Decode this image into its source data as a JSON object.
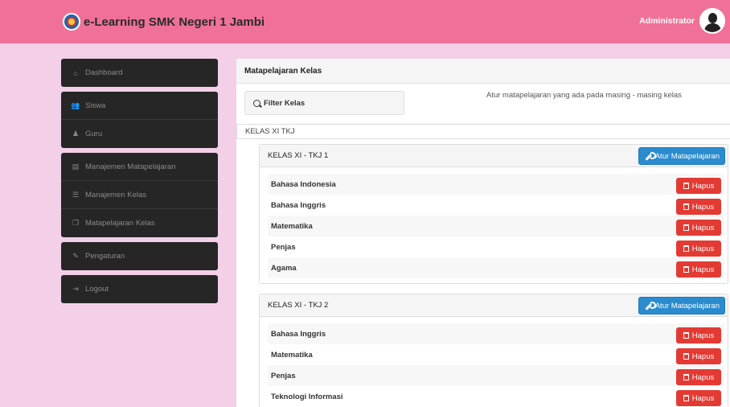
{
  "header": {
    "brand": "e-Learning SMK Negeri 1 Jambi",
    "user": "Administrator"
  },
  "sidebar": {
    "groups": [
      [
        {
          "label": "Dashboard",
          "icon": "home-icon"
        }
      ],
      [
        {
          "label": "Siswa",
          "icon": "users-icon"
        },
        {
          "label": "Guru",
          "icon": "user-icon"
        }
      ],
      [
        {
          "label": "Manajemen Matapelajaran",
          "icon": "book-icon"
        },
        {
          "label": "Manajemen Kelas",
          "icon": "list-icon"
        },
        {
          "label": "Matapelajaran Kelas",
          "icon": "copy-icon"
        }
      ],
      [
        {
          "label": "Pengaturan",
          "icon": "wrench-icon"
        }
      ],
      [
        {
          "label": "Logout",
          "icon": "logout-icon"
        }
      ]
    ]
  },
  "main": {
    "title": "Matapelajaran Kelas",
    "filter_label": "Filter Kelas",
    "description": "Atur matapelajaran yang ada pada masing - masing kelas",
    "section": "KELAS XI TKJ",
    "atur_label": "Atur Matapelajaran",
    "hapus_label": "Hapus",
    "classes": [
      {
        "name": "KELAS XI - TKJ 1",
        "subjects": [
          "Bahasa Indonesia",
          "Bahasa Inggris",
          "Matematika",
          "Penjas",
          "Agama"
        ]
      },
      {
        "name": "KELAS XI - TKJ 2",
        "subjects": [
          "Bahasa Inggris",
          "Matematika",
          "Penjas",
          "Teknologi Informasi"
        ]
      }
    ]
  },
  "colors": {
    "topbar": "#f07197",
    "background": "#f3cfe8",
    "sidebar": "#262626",
    "primary": "#2a8ccf",
    "danger": "#e33b34"
  }
}
